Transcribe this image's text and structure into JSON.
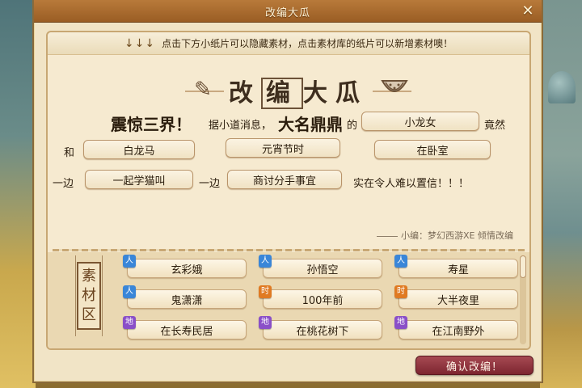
{
  "window": {
    "title": "改编大瓜",
    "close_symbol": "✕"
  },
  "hint": {
    "arrows": "↓↓↓",
    "text": "点击下方小纸片可以隐藏素材，点击素材库的纸片可以新增素材噢！"
  },
  "banner": {
    "chars": [
      "改",
      "编",
      "大",
      "瓜"
    ]
  },
  "story": {
    "opening": "震惊三界！",
    "intro": "据小道消息，",
    "famous": "大名鼎鼎",
    "de": "的",
    "who": "小龙女",
    "jingran": "竟然",
    "he": "和",
    "partner": "白龙马",
    "when": "元宵节时",
    "where": "在卧室",
    "yibian1": "一边",
    "action1": "一起学猫叫",
    "yibian2": "一边",
    "action2": "商讨分手事宜",
    "ending": "实在令人难以置信！！！",
    "credit": "小编：梦幻西游XE 倾情改编"
  },
  "material": {
    "label": [
      "素",
      "材",
      "区"
    ],
    "cards": [
      {
        "tag": "人",
        "text": "玄彩娥",
        "tag_color": "#3a86d8"
      },
      {
        "tag": "人",
        "text": "孙悟空",
        "tag_color": "#3a86d8"
      },
      {
        "tag": "人",
        "text": "寿星",
        "tag_color": "#3a86d8"
      },
      {
        "tag": "人",
        "text": "鬼潇潇",
        "tag_color": "#3a86d8"
      },
      {
        "tag": "时",
        "text": "100年前",
        "tag_color": "#e07a22"
      },
      {
        "tag": "时",
        "text": "大半夜里",
        "tag_color": "#e07a22"
      },
      {
        "tag": "地",
        "text": "在长寿民居",
        "tag_color": "#8a4fc8"
      },
      {
        "tag": "地",
        "text": "在桃花树下",
        "tag_color": "#8a4fc8"
      },
      {
        "tag": "地",
        "text": "在江南野外",
        "tag_color": "#8a4fc8"
      }
    ]
  },
  "confirm_label": "确认改编！"
}
